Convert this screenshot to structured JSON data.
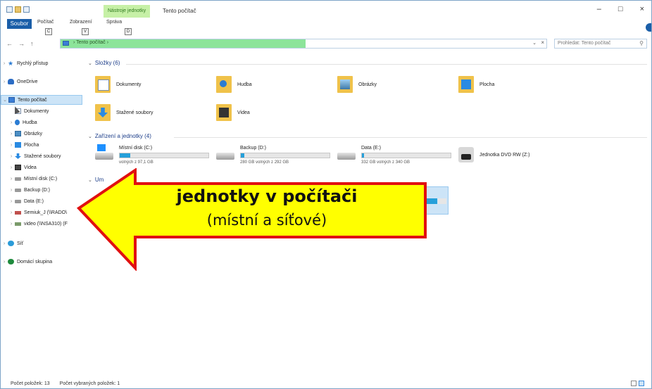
{
  "window": {
    "title": "Tento počítač",
    "context_tab": "Nástroje jednotky",
    "controls": {
      "minimize": "–",
      "maximize": "□",
      "close": "×"
    }
  },
  "ribbon": {
    "file_tab": "Soubor",
    "tabs": [
      "Počítač",
      "Zobrazení",
      "Správa"
    ],
    "keytips": [
      "C",
      "V",
      "D"
    ]
  },
  "nav": {
    "back": "←",
    "forward": "→",
    "up": "↑",
    "breadcrumb": "› Tento počítač ›",
    "dropdown": "⌄",
    "clear": "×",
    "search_placeholder": "Prohledat: Tento počítač",
    "search_icon": "search-icon"
  },
  "sidebar": {
    "items": [
      {
        "label": "Rychlý přístup",
        "icon": "star-icon"
      },
      {
        "label": "OneDrive",
        "icon": "cloud-icon"
      },
      {
        "label": "Tento počítač",
        "icon": "pc-icon",
        "selected": true
      },
      {
        "label": "Dokumenty",
        "icon": "document-folder-icon"
      },
      {
        "label": "Hudba",
        "icon": "music-folder-icon"
      },
      {
        "label": "Obrázky",
        "icon": "pictures-folder-icon"
      },
      {
        "label": "Plocha",
        "icon": "desktop-folder-icon"
      },
      {
        "label": "Stažené soubory",
        "icon": "downloads-folder-icon"
      },
      {
        "label": "Videa",
        "icon": "videos-folder-icon"
      },
      {
        "label": "Místní disk (C:)",
        "icon": "local-disk-icon"
      },
      {
        "label": "Backup (D:)",
        "icon": "drive-icon"
      },
      {
        "label": "Data (E:)",
        "icon": "drive-icon"
      },
      {
        "label": "Semiuk_J (\\\\RADO\\",
        "icon": "network-drive-icon"
      },
      {
        "label": "video (\\\\NSA310) (F",
        "icon": "network-drive-icon"
      },
      {
        "label": "Síť",
        "icon": "network-icon"
      },
      {
        "label": "Domácí skupina",
        "icon": "homegroup-icon"
      }
    ]
  },
  "content": {
    "folders_header": "Složky (6)",
    "folders": [
      {
        "label": "Dokumenty",
        "icon": "documents-folder-icon"
      },
      {
        "label": "Hudba",
        "icon": "music-folder-icon"
      },
      {
        "label": "Obrázky",
        "icon": "pictures-folder-icon"
      },
      {
        "label": "Plocha",
        "icon": "desktop-folder-icon"
      },
      {
        "label": "Stažené soubory",
        "icon": "downloads-folder-icon"
      },
      {
        "label": "Videa",
        "icon": "videos-folder-icon"
      }
    ],
    "devices_header": "Zařízení a jednotky (4)",
    "drives": [
      {
        "name": "Místní disk (C:)",
        "free": "volných z 97,1 GB",
        "used_fraction": 0.12
      },
      {
        "name": "Backup (D:)",
        "free": "280 GB volných z 292 GB",
        "used_fraction": 0.04
      },
      {
        "name": "Data (E:)",
        "free": "332 GB volných z 340 GB",
        "used_fraction": 0.02
      },
      {
        "name": "Jednotka DVD RW (Z:)",
        "icon": "dvd-drive-icon"
      }
    ],
    "network_header_partial": "Um",
    "network_used_fraction": 0.65
  },
  "callout": {
    "line1": "jednotky v počítači",
    "line2": "(místní a síťové)",
    "fill": "#ffff00",
    "stroke": "#e01010"
  },
  "status": {
    "items_count": "Počet položek: 13",
    "selected_count": "Počet vybraných položek: 1"
  }
}
